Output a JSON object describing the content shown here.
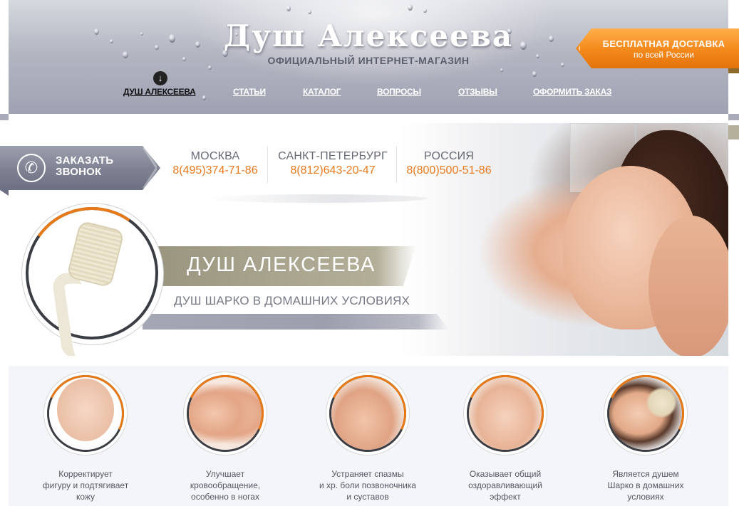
{
  "header": {
    "title": "Душ Алексеева",
    "subtitle": "ОФИЦИАЛЬНЫЙ ИНТЕРНЕТ-МАГАЗИН",
    "nav": [
      {
        "label": "ДУШ АЛЕКСЕЕВА",
        "active": true
      },
      {
        "label": "СТАТЬИ"
      },
      {
        "label": "КАТАЛОГ"
      },
      {
        "label": "ВОПРОСЫ"
      },
      {
        "label": "ОТЗЫВЫ"
      },
      {
        "label": "ОФОРМИТЬ ЗАКАЗ"
      }
    ],
    "active_marker_icon": "arrow-down-icon"
  },
  "delivery": {
    "line1": "БЕСПЛАТНАЯ ДОСТАВКА",
    "line2": "по всей России"
  },
  "callback": {
    "icon": "phone-icon",
    "line1": "ЗАКАЗАТЬ",
    "line2": "ЗВОНОК"
  },
  "contacts": [
    {
      "city": "МОСКВА",
      "phone": "8(495)374-71-86"
    },
    {
      "city": "САНКТ-ПЕТЕРБУРГ",
      "phone": "8(812)643-20-47"
    },
    {
      "city": "РОССИЯ",
      "phone": "8(800)500-51-86"
    }
  ],
  "banner": {
    "title": "ДУШ АЛЕКСЕЕВА",
    "subtitle": "ДУШ ШАРКО В ДОМАШНИХ УСЛОВИЯХ"
  },
  "features": [
    {
      "text": "Корректирует\nфигуру и подтягивает\nкожу"
    },
    {
      "text": "Улучшает\nкровообращение,\nособенно в ногах"
    },
    {
      "text": "Устраняет спазмы\nи хр. боли позвоночника\nи суставов"
    },
    {
      "text": "Оказывает общий\nоздоравливающий\nэффект"
    },
    {
      "text": "Является душем\nШарко в домашних\nусловиях"
    }
  ],
  "colors": {
    "accent_orange": "#ea7a1d",
    "header_gray": "#9fa2b2",
    "text_gray": "#666a75"
  }
}
